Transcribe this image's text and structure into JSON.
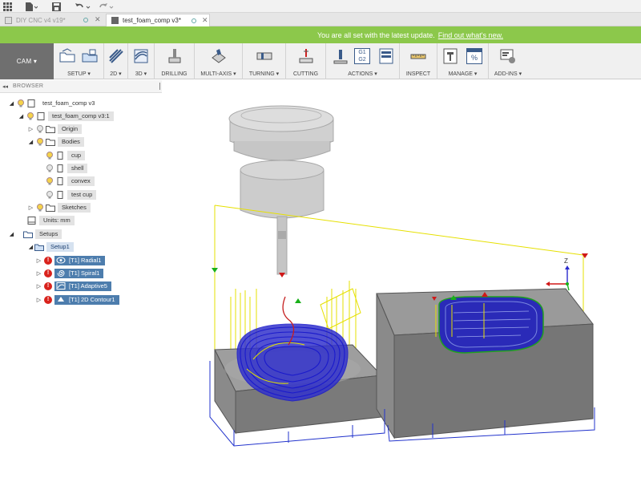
{
  "tabs": [
    {
      "label": "DIY CNC v4 v19*",
      "active": false
    },
    {
      "label": "test_foam_comp v3*",
      "active": true
    }
  ],
  "banner": {
    "message": "You are all set with the latest update.",
    "link": "Find out what's new."
  },
  "toolbar": {
    "workspace": "CAM ▾",
    "groups": [
      {
        "label": "SETUP ▾"
      },
      {
        "label": "2D ▾"
      },
      {
        "label": "3D ▾"
      },
      {
        "label": "DRILLING"
      },
      {
        "label": "MULTI-AXIS ▾"
      },
      {
        "label": "TURNING ▾"
      },
      {
        "label": "CUTTING"
      },
      {
        "label": "ACTIONS ▾"
      },
      {
        "label": "INSPECT"
      },
      {
        "label": "MANAGE ▾"
      },
      {
        "label": "ADD-INS ▾"
      }
    ],
    "g1g2_top": "G1",
    "g1g2_bottom": "G2",
    "percent": "%"
  },
  "browser": {
    "title": "BROWSER",
    "nodes": [
      {
        "label": "test_foam_comp v3"
      },
      {
        "label": "test_foam_comp v3:1"
      },
      {
        "label": "Origin"
      },
      {
        "label": "Bodies"
      },
      {
        "label": "cup"
      },
      {
        "label": "shell"
      },
      {
        "label": "convex"
      },
      {
        "label": "test cup"
      },
      {
        "label": "Sketches"
      },
      {
        "label": "Units: mm"
      },
      {
        "label": "Setups"
      },
      {
        "label": "Setup1"
      },
      {
        "label": "[T1] Radial1"
      },
      {
        "label": "[T1] Spiral1"
      },
      {
        "label": "[T1] Adaptive5"
      },
      {
        "label": "[T1] 2D Contour1"
      }
    ]
  },
  "viewport": {
    "axis_z": "Z"
  },
  "colors": {
    "banner": "#8cc84b",
    "cam_button": "#6f6f6f",
    "operation_highlight": "#4d7dad",
    "error": "#d9221c",
    "toolpath": "#1a1acc",
    "rapid_moves": "#e6e000",
    "stock": "#8a8a8a"
  }
}
